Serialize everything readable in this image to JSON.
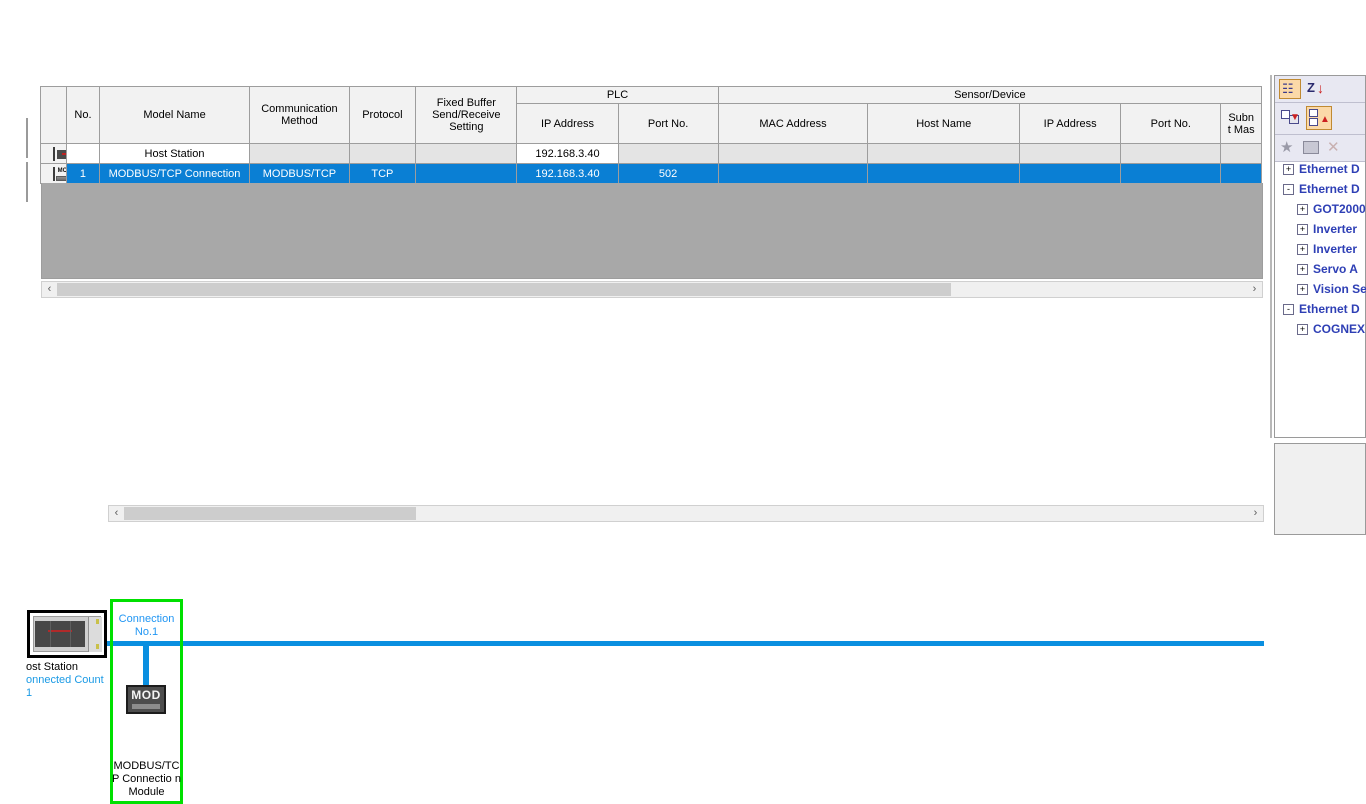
{
  "table": {
    "group_headers": [
      {
        "label": "",
        "span": 6
      },
      {
        "label": "PLC",
        "span": 2
      },
      {
        "label": "Sensor/Device",
        "span": 5
      }
    ],
    "columns": [
      "",
      "No.",
      "Model Name",
      "Communication\nMethod",
      "Protocol",
      "Fixed Buffer\nSend/Receive\nSetting",
      "IP Address",
      "Port No.",
      "MAC Address",
      "Host Name",
      "IP Address",
      "Port No.",
      "Subn\nt Mas"
    ],
    "rows": [
      {
        "icon": "host-station-icon",
        "selected": false,
        "cells": [
          "",
          "Host Station",
          "",
          "",
          "",
          "192.168.3.40",
          "",
          "",
          "",
          "",
          "",
          ""
        ]
      },
      {
        "icon": "modbus-module-icon",
        "selected": true,
        "cells": [
          "1",
          "MODBUS/TCP Connection",
          "MODBUS/TCP",
          "TCP",
          "",
          "192.168.3.40",
          "502",
          "",
          "",
          "",
          "",
          ""
        ]
      }
    ]
  },
  "diagram": {
    "host_station_label": "ost Station",
    "connected_count_label": "onnected Count",
    "connected_count_value": "1",
    "connection_title": "Connection\nNo.1",
    "module_badge": "MOD",
    "module_caption": "MODBUS/TC\nP Connectio\nn Module",
    "selection_color": "#00e000",
    "network_line_color": "#0a8fe0",
    "link_text_color": "#1a9ae5"
  },
  "right_dock": {
    "toolbar_row1": [
      {
        "name": "sort-category-button",
        "glyph": "sort-icon",
        "active": true
      },
      {
        "name": "sort-alpha-desc-button",
        "glyph": "z-arrow-down-icon",
        "active": false
      }
    ],
    "toolbar_row2": [
      {
        "name": "collapse-all-button",
        "glyph": "collapse-icon",
        "active": false
      },
      {
        "name": "expand-all-button",
        "glyph": "expand-icon",
        "active": true
      }
    ],
    "toolbar_row3": [
      {
        "name": "favorite-button",
        "glyph": "star-icon",
        "disabled": true
      },
      {
        "name": "add-to-favorites-button",
        "glyph": "folder-add-icon",
        "disabled": true
      },
      {
        "name": "delete-button",
        "glyph": "close-x-icon",
        "disabled": true
      }
    ],
    "tree": [
      {
        "label": "Ethernet D",
        "level": 0,
        "state": "+"
      },
      {
        "label": "Ethernet D",
        "level": 0,
        "state": "-"
      },
      {
        "label": "GOT2000",
        "level": 1,
        "state": "+"
      },
      {
        "label": "Inverter",
        "level": 1,
        "state": "+"
      },
      {
        "label": "Inverter",
        "level": 1,
        "state": "+"
      },
      {
        "label": "Servo A",
        "level": 1,
        "state": "+"
      },
      {
        "label": "Vision Se",
        "level": 1,
        "state": "+"
      },
      {
        "label": "Ethernet D",
        "level": 0,
        "state": "-"
      },
      {
        "label": "COGNEX",
        "level": 1,
        "state": "+"
      }
    ]
  },
  "scrollbars": {
    "table_left_arrow": "‹",
    "table_right_arrow": "›",
    "diagram_left_arrow": "‹",
    "diagram_right_arrow": "›"
  }
}
